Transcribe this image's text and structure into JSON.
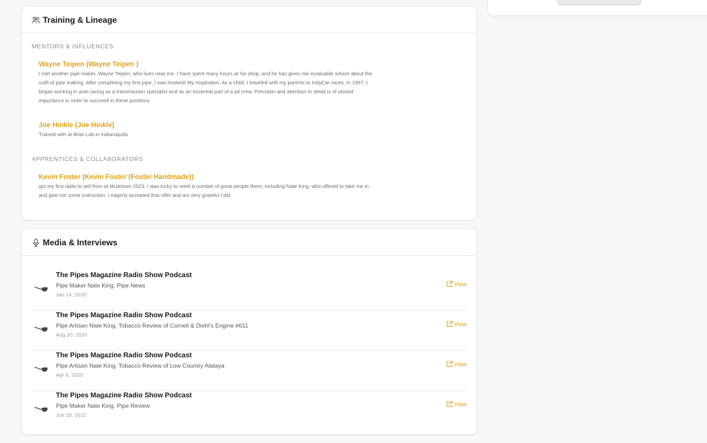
{
  "training": {
    "title": "Training & Lineage",
    "mentors_label": "MENTORS & INFLUENCES",
    "mentors": [
      {
        "name": "Wayne Teipen (Wayne Teipen )",
        "lines": [
          "I met another pipe maker, Wayne Teipen, who lives near me. I have spent many hours at his shop, and he has given me invaluable advice about the",
          "craft of pipe making. After completing my first pipe, I was hooked! My Inspiration: As a child, I traveled with my parents to IndyCar races. In 1997, I",
          "began working in auto racing as a transmission specialist and as an essential part of a pit crew. Precision and attention to detail is of utmost",
          "importance in order to succeed in these positions."
        ]
      },
      {
        "name": "Joe Hinkle (Joe Hinkle)",
        "lines": [
          "Trained with at Briar Lab in Indianapolis"
        ]
      }
    ],
    "apprentices_label": "APPRENTICES & COLLABORATORS",
    "apprentices": [
      {
        "name": "Kevin Foster (Kevin Foster (Foster Handmade))",
        "lines": [
          "got my first table to sell from at Muletown 2023. I was lucky to meet a number of great people there, including Nate King, who offered to take me in",
          "and give me some instruction. I eagerly accepted that offer and am very grateful I did."
        ]
      }
    ]
  },
  "media": {
    "title": "Media & Interviews",
    "view_label": "View",
    "items": [
      {
        "title": "The Pipes Magazine Radio Show Podcast",
        "subtitle": "Pipe Maker Nate King. Pipe News",
        "date": "Jan 14, 2026"
      },
      {
        "title": "The Pipes Magazine Radio Show Podcast",
        "subtitle": "Pipe Artisan Nate King. Tobacco Review of Cornell & Diehl's Engine #611",
        "date": "Aug 20, 2025"
      },
      {
        "title": "The Pipes Magazine Radio Show Podcast",
        "subtitle": "Pipe Artisan Nate King. Tobacco Review of Low Country Atalaya",
        "date": "Apr 9, 2025"
      },
      {
        "title": "The Pipes Magazine Radio Show Podcast",
        "subtitle": "Pipe Maker Nate King. Pipe Review",
        "date": "Jun 29, 2022"
      }
    ]
  },
  "colors": {
    "accent": "#e0a21d",
    "card_bg": "#ffffff",
    "page_bg": "#f7f7f7"
  },
  "icons": {
    "training": "users-icon",
    "media": "microphone-icon",
    "media_item": "pipe-icon",
    "view": "external-link-icon"
  }
}
